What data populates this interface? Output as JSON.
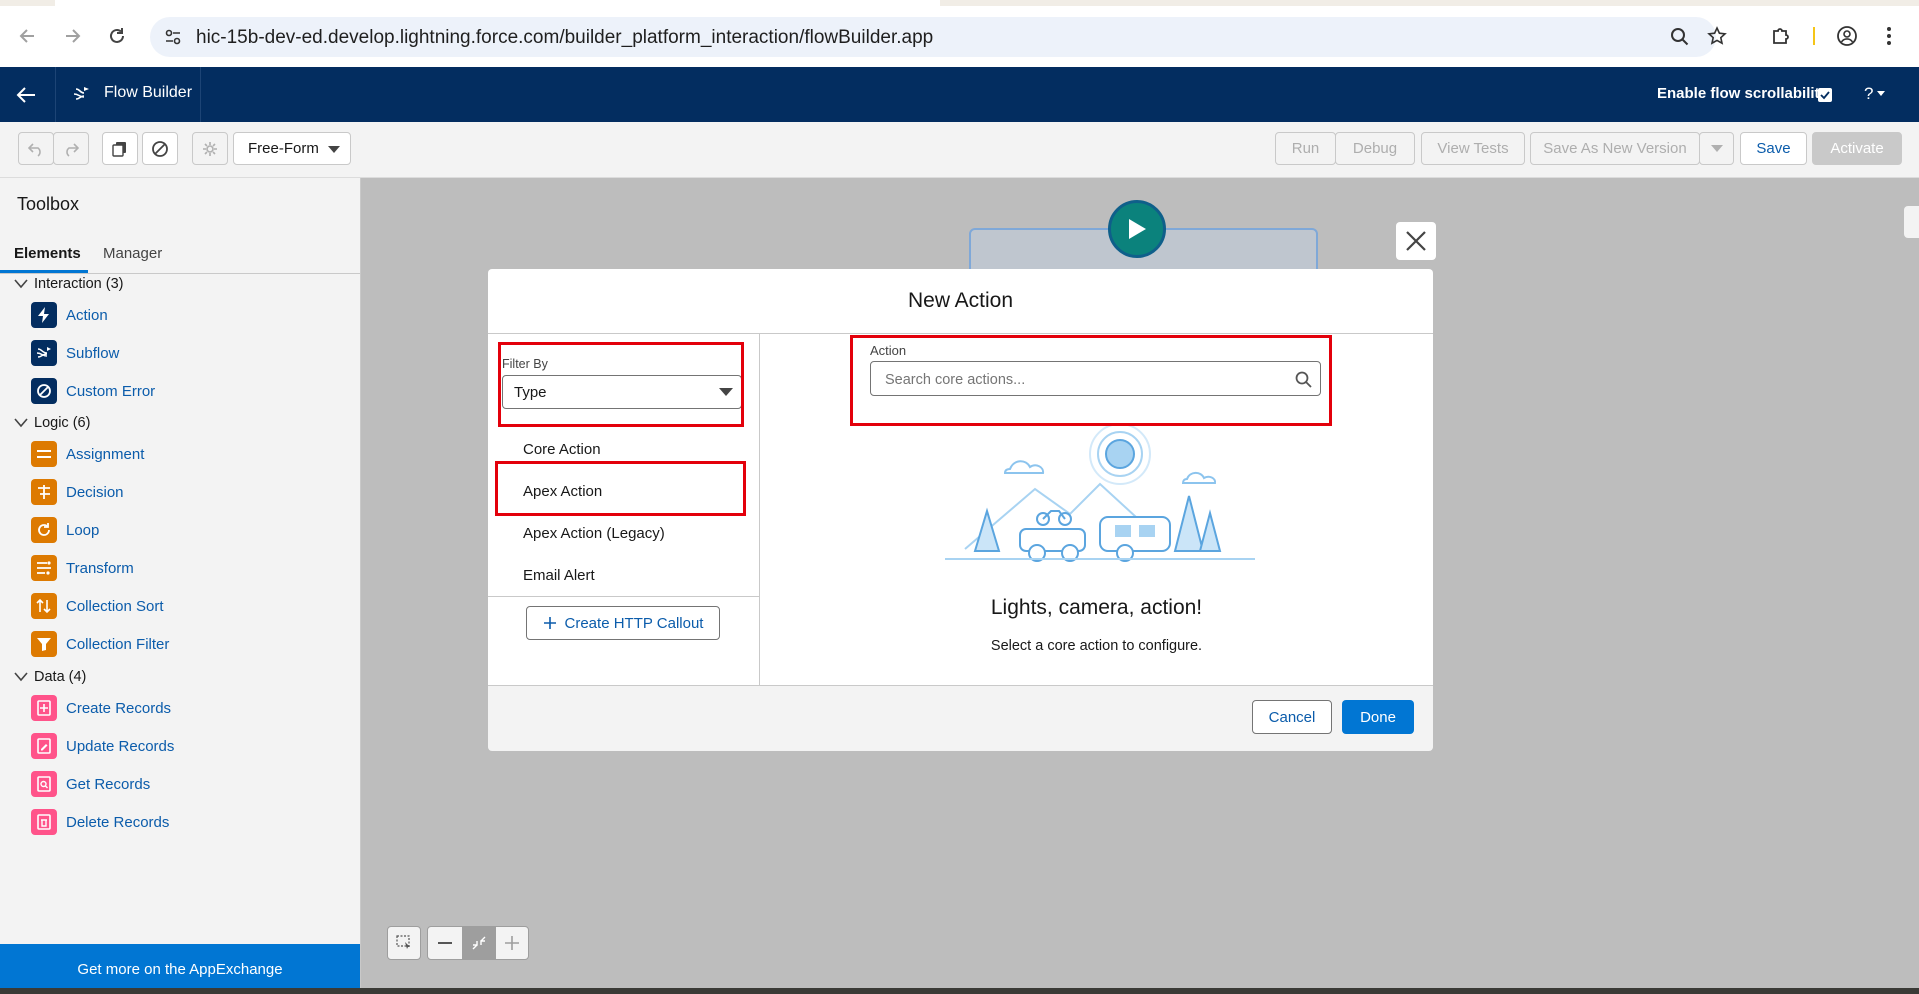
{
  "browser": {
    "url": "hic-15b-dev-ed.develop.lightning.force.com/builder_platform_interaction/flowBuilder.app"
  },
  "app_header": {
    "title": "Flow Builder",
    "scrollability_label": "Enable flow scrollability",
    "help_label": "?"
  },
  "toolbar": {
    "mode_select": "Free-Form",
    "run": "Run",
    "debug": "Debug",
    "view_tests": "View Tests",
    "save_as_new": "Save As New Version",
    "save": "Save",
    "activate": "Activate"
  },
  "sidebar": {
    "title": "Toolbox",
    "tabs": [
      "Elements",
      "Manager"
    ],
    "sections": [
      {
        "label": "Interaction (3)",
        "items": [
          "Action",
          "Subflow",
          "Custom Error"
        ]
      },
      {
        "label": "Logic (6)",
        "items": [
          "Assignment",
          "Decision",
          "Loop",
          "Transform",
          "Collection Sort",
          "Collection Filter"
        ]
      },
      {
        "label": "Data (4)",
        "items": [
          "Create Records",
          "Update Records",
          "Get Records",
          "Delete Records"
        ]
      }
    ],
    "appexchange": "Get more on the AppExchange"
  },
  "modal": {
    "title": "New Action",
    "filter_label": "Filter By",
    "filter_value": "Type",
    "categories": [
      "Core Action",
      "Apex Action",
      "Apex Action (Legacy)",
      "Email Alert"
    ],
    "create_http": "Create HTTP Callout",
    "action_label": "Action",
    "search_placeholder": "Search core actions...",
    "empty_title": "Lights, camera, action!",
    "empty_sub": "Select a core action to configure.",
    "cancel": "Cancel",
    "done": "Done"
  },
  "colors": {
    "header_navy": "#032d60",
    "brand_blue": "#0176d3",
    "highlight_red": "#e3000b",
    "logic_orange": "#dd7a01",
    "data_pink": "#ff538a"
  }
}
